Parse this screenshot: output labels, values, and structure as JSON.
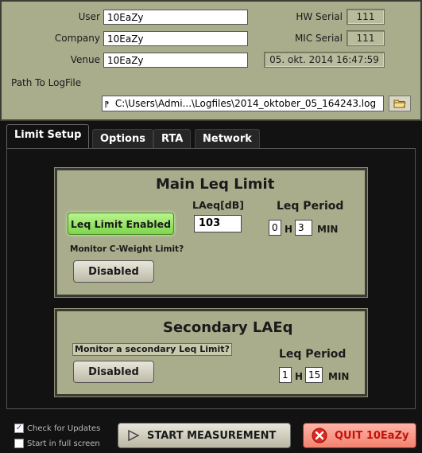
{
  "info": {
    "user_label": "User",
    "user_value": "10EaZy",
    "company_label": "Company",
    "company_value": "10EaZy",
    "venue_label": "Venue",
    "venue_value": "10EaZy",
    "path_label": "Path To LogFile",
    "path_prefix": "⁋",
    "path_value": "C:\\Users\\Admi...\\Logfiles\\2014_oktober_05_164243.log",
    "hw_serial_label": "HW Serial",
    "hw_serial_value": "111",
    "mic_serial_label": "MIC Serial",
    "mic_serial_value": "111",
    "datetime": "05. okt. 2014 16:47:59"
  },
  "tabs": [
    {
      "label": "Limit Setup",
      "active": true
    },
    {
      "label": "Options",
      "active": false
    },
    {
      "label": "RTA",
      "active": false
    },
    {
      "label": "Network",
      "active": false
    }
  ],
  "main_limit": {
    "title": "Main Leq Limit",
    "enabled_button": "Leq Limit Enabled",
    "laeq_label": "LAeq[dB]",
    "laeq_value": "103",
    "period_label": "Leq Period",
    "period_hours": "0",
    "hours_unit": "H",
    "period_minutes": "3",
    "minutes_unit": "MIN",
    "cweight_label": "Monitor C-Weight Limit?",
    "cweight_button": "Disabled"
  },
  "secondary_limit": {
    "title": "Secondary LAEq",
    "monitor_label": "Monitor a secondary Leq Limit?",
    "monitor_button": "Disabled",
    "period_label": "Leq Period",
    "period_hours": "1",
    "hours_unit": "H",
    "period_minutes": "15",
    "minutes_unit": "MIN"
  },
  "footer": {
    "check_updates_label": "Check for Updates",
    "check_updates_checked": true,
    "fullscreen_label": "Start in full screen",
    "fullscreen_checked": false,
    "start_button": "START MEASUREMENT",
    "quit_button": "QUIT 10EaZy"
  },
  "colors": {
    "panel": "#a9ad8c",
    "background": "#121212",
    "enabled_green": "#8be05a",
    "quit_red": "#e04a3a"
  }
}
